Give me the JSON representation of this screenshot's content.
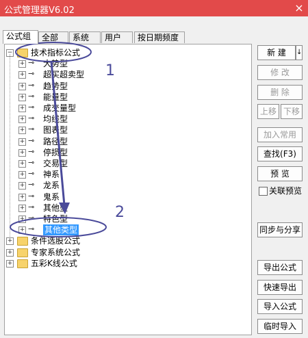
{
  "window": {
    "title": "公式管理器V6.02",
    "close_glyph": "×"
  },
  "tabs": [
    "公式组",
    "全部",
    "系统",
    "用户",
    "按日期频度"
  ],
  "tree": {
    "root": "技术指标公式",
    "children": [
      "大势型",
      "超买超卖型",
      "趋势型",
      "能量型",
      "成交量型",
      "均线型",
      "图表型",
      "路径型",
      "停损型",
      "交易型",
      "神系",
      "龙系",
      "鬼系",
      "其他型",
      "特色型",
      "其他类型"
    ],
    "selected": "其他类型",
    "siblings": [
      "条件选股公式",
      "专家系统公式",
      "五彩K线公式"
    ]
  },
  "buttons": {
    "new": "新  建",
    "new_arrow": "↓",
    "modify": "修  改",
    "delete": "删  除",
    "move_up": "上移",
    "move_down": "下移",
    "add_common": "加入常用",
    "find": "查找(F3)",
    "preview": "预  览",
    "link_preview": "关联预览",
    "sync_share": "同步与分享",
    "export": "导出公式",
    "quick_export": "快速导出",
    "import": "导入公式",
    "temp_import": "临时导入"
  },
  "annotations": {
    "one": "1",
    "two": "2"
  },
  "colors": {
    "titlebar": "#e24a4a",
    "selection": "#3399ff",
    "annotation": "#4a4a9a"
  }
}
